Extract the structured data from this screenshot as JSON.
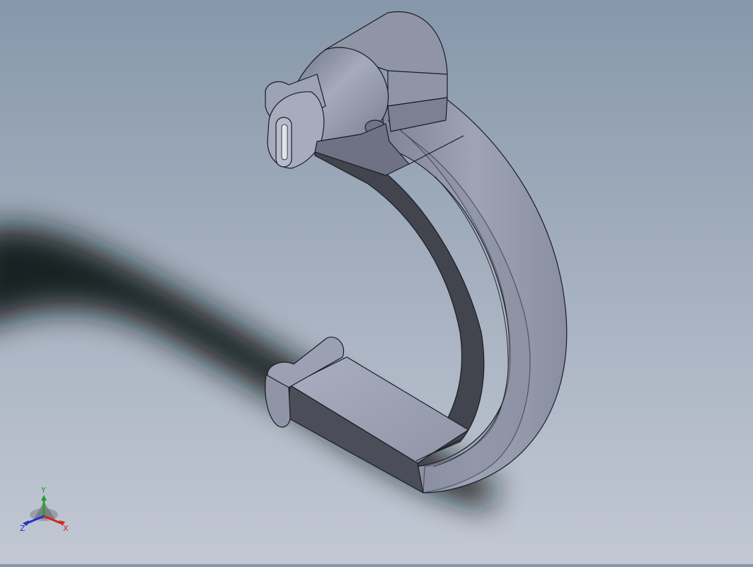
{
  "viewport": {
    "colors": {
      "background_top": "#8797ab",
      "background_bottom": "#c2c8d4",
      "part_face_light": "#a1a6b9",
      "part_face_mid": "#8c90a3",
      "part_face_dark": "#454852",
      "edge": "#1a1c22",
      "shadow": "#111317"
    }
  },
  "triad": {
    "x_label": "X",
    "y_label": "Y",
    "z_label": "Z",
    "x_color": "#d0281e",
    "y_color": "#22a02a",
    "z_color": "#2431c8"
  }
}
